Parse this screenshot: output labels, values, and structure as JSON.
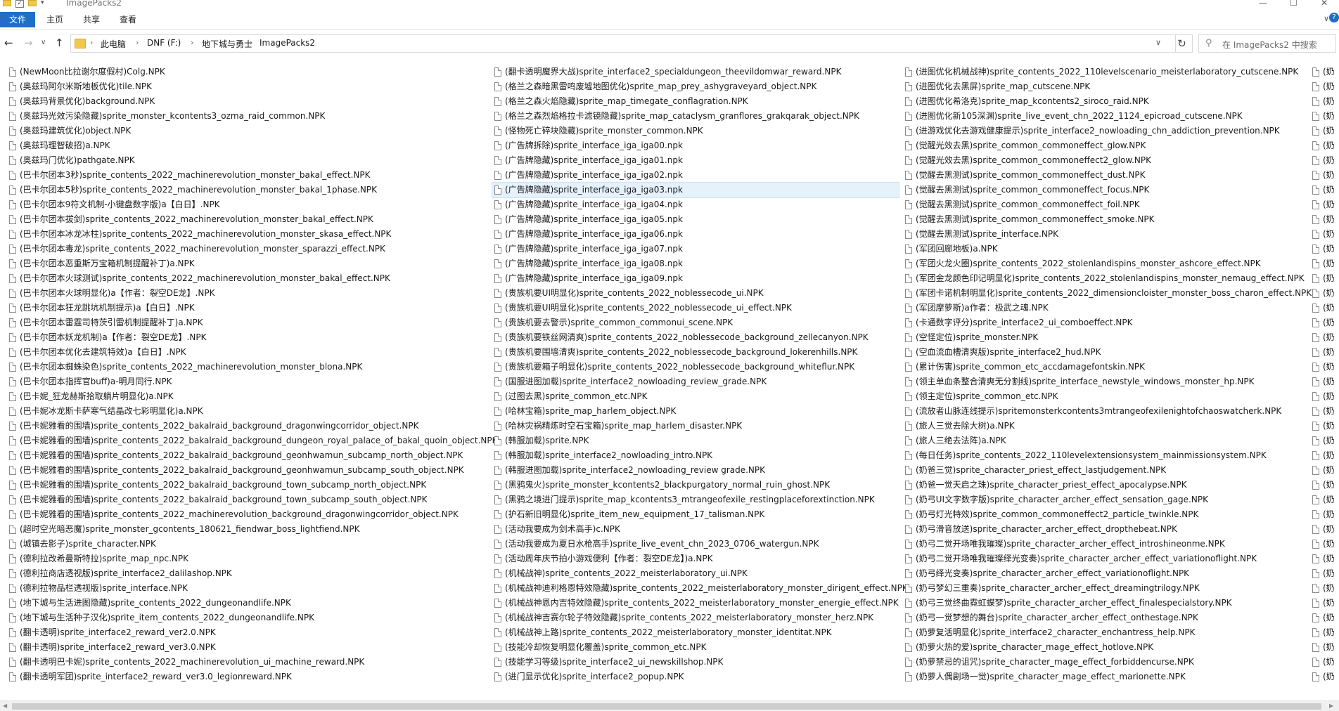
{
  "window": {
    "title": "ImagePacks2",
    "controls": {
      "minimize": "—",
      "maximize": "☐",
      "close": "✕"
    }
  },
  "ribbon": {
    "tabs": [
      "文件",
      "主页",
      "共享",
      "查看"
    ],
    "expand_glyph": "∨",
    "help_glyph": "?"
  },
  "nav": {
    "back_glyph": "←",
    "forward_glyph": "→",
    "recent_glyph": "∨",
    "up_glyph": "↑",
    "breadcrumb": [
      "此电脑",
      "DNF (F:)",
      "地下城与勇士",
      "ImagePacks2"
    ],
    "separator_glyph": "›",
    "dropdown_glyph": "∨",
    "refresh_glyph": "↻",
    "search_placeholder": "在 ImagePacks2 中搜索",
    "search_icon": "magnifier-icon"
  },
  "files": {
    "columns": [
      [
        "(NewMoon比拉谢尔度假村)Colg.NPK",
        "(奥兹玛阿尔米斯地板优化)tile.NPK",
        "(奥兹玛背景优化)background.NPK",
        "(奥兹玛光效污染隐藏)sprite_monster_kcontents3_ozma_raid_common.NPK",
        "(奥兹玛建筑优化)object.NPK",
        "(奥兹玛理智破招)a.NPK",
        "(奥兹玛门优化)pathgate.NPK",
        "(巴卡尔团本3秒)sprite_contents_2022_machinerevolution_monster_bakal_effect.NPK",
        "(巴卡尔团本5秒)sprite_contents_2022_machinerevolution_monster_bakal_1phase.NPK",
        "(巴卡尔团本9符文机制-小键盘数字版)a【白日】.NPK",
        "(巴卡尔团本拔剑)sprite_contents_2022_machinerevolution_monster_bakal_effect.NPK",
        "(巴卡尔团本冰龙冰柱)sprite_contents_2022_machinerevolution_monster_skasa_effect.NPK",
        "(巴卡尔团本毒龙)sprite_contents_2022_machinerevolution_monster_sparazzi_effect.NPK",
        "(巴卡尔团本恶重斯万宝箱机制提醒补丁)a.NPK",
        "(巴卡尔团本火球测试)sprite_contents_2022_machinerevolution_monster_bakal_effect.NPK",
        "(巴卡尔团本火球明显化)a【作者：裂空DE龙】.NPK",
        "(巴卡尔团本狂龙跳坑机制提示)a【白日】.NPK",
        "(巴卡尔团本雷霆司特茨引雷机制提醒补丁)a.NPK",
        "(巴卡尔团本妖龙机制)a【作者：裂空DE龙】.NPK",
        "(巴卡尔团本优化去建筑特效)a【白日】.NPK",
        "(巴卡尔团本蜘蛛染色)sprite_contents_2022_machinerevolution_monster_blona.NPK",
        "(巴卡尔团本指挥官buff)a-明月同行.NPK",
        "(巴卡妮_狂龙赫斯拾取躺片明显化)a.NPK",
        "(巴卡妮冰龙斯卡萨寒气结晶改七彩明显化)a.NPK",
        "(巴卡妮雅看的围墙)sprite_contents_2022_bakalraid_background_dragonwingcorridor_object.NPK",
        "(巴卡妮雅看的围墙)sprite_contents_2022_bakalraid_background_dungeon_royal_palace_of_bakal_quoin_object.NPK",
        "(巴卡妮雅看的围墙)sprite_contents_2022_bakalraid_background_geonhwamun_subcamp_north_object.NPK",
        "(巴卡妮雅看的围墙)sprite_contents_2022_bakalraid_background_geonhwamun_subcamp_south_object.NPK",
        "(巴卡妮雅看的围墙)sprite_contents_2022_bakalraid_background_town_subcamp_north_object.NPK",
        "(巴卡妮雅看的围墙)sprite_contents_2022_bakalraid_background_town_subcamp_south_object.NPK",
        "(巴卡妮雅看的围墙)sprite_contents_2022_machinerevolution_background_dragonwingcorridor_object.NPK",
        "(超时空光暗恶魔)sprite_monster_gcontents_180621_fiendwar_boss_lightfiend.NPK",
        "(城镇去影子)sprite_character.NPK",
        "(德利拉改希曼斯特拉)sprite_map_npc.NPK",
        "(德利拉商店透视版)sprite_interface2_dalilashop.NPK",
        "(德利拉物品栏透视版)sprite_interface.NPK",
        "(地下城与生活进图隐藏)sprite_contents_2022_dungeonandlife.NPK",
        "(地下城与生活种子汉化)sprite_item_contents_2022_dungeonandlife.NPK",
        "(翻卡透明)sprite_interface2_reward_ver2.0.NPK",
        "(翻卡透明)sprite_interface2_reward_ver3.0.NPK",
        "(翻卡透明巴卡妮)sprite_contents_2022_machinerevolution_ui_machine_reward.NPK",
        "(翻卡透明军团)sprite_interface2_reward_ver3.0_legionreward.NPK"
      ],
      [
        "(翻卡透明魔界大战)sprite_interface2_specialdungeon_theevildomwar_reward.NPK",
        "(格兰之森暗黑雷鸣废墟地图优化)sprite_map_prey_ashygraveyard_object.NPK",
        "(格兰之森火焰隐藏)sprite_map_timegate_conflagration.NPK",
        "(格兰之森烈焰格拉卡滤镜隐藏)sprite_map_cataclysm_granflores_grakqarak_object.NPK",
        "(怪物死亡碎块隐藏)sprite_monster_common.NPK",
        "(广告牌拆除)sprite_interface_iga_iga00.npk",
        "(广告牌隐藏)sprite_interface_iga_iga01.npk",
        "(广告牌隐藏)sprite_interface_iga_iga02.npk",
        "(广告牌隐藏)sprite_interface_iga_iga03.npk",
        "(广告牌隐藏)sprite_interface_iga_iga04.npk",
        "(广告牌隐藏)sprite_interface_iga_iga05.npk",
        "(广告牌隐藏)sprite_interface_iga_iga06.npk",
        "(广告牌隐藏)sprite_interface_iga_iga07.npk",
        "(广告牌隐藏)sprite_interface_iga_iga08.npk",
        "(广告牌隐藏)sprite_interface_iga_iga09.npk",
        "(贵族机要UI明显化)sprite_contents_2022_noblessecode_ui.NPK",
        "(贵族机要UI明显化)sprite_contents_2022_noblessecode_ui_effect.NPK",
        "(贵族机要去警示)sprite_common_commonui_scene.NPK",
        "(贵族机要铁丝网清爽)sprite_contents_2022_noblessecode_background_zellecanyon.NPK",
        "(贵族机要围墙清爽)sprite_contents_2022_noblessecode_background_lokerenhills.NPK",
        "(贵族机要箱子明显化)sprite_contents_2022_noblessecode_background_whiteflur.NPK",
        "(国服进图加载)sprite_interface2_nowloading_review_grade.NPK",
        "(过图去黑)sprite_common_etc.NPK",
        "(哈林宝箱)sprite_map_harlem_object.NPK",
        "(哈林灾祸精炼时空石宝箱)sprite_map_harlem_disaster.NPK",
        "(韩服加载)sprite.NPK",
        "(韩服加载)sprite_interface2_nowloading_intro.NPK",
        "(韩服进图加载)sprite_interface2_nowloading_review grade.NPK",
        "(黑鸦鬼火)sprite_monster_kcontents2_blackpurgatory_normal_ruin_ghost.NPK",
        "(黑鸦之境进门提示)sprite_map_kcontents3_mtrangeofexile_restingplaceforextinction.NPK",
        "(护石新旧明显化)sprite_item_new_equipment_17_talisman.NPK",
        "(活动我要成为剑术高手)c.NPK",
        "(活动我要成为夏日水枪高手)sprite_live_event_chn_2023_0706_watergun.NPK",
        "(活动周年庆节拍小游戏便利【作者：裂空DE龙】)a.NPK",
        "(机械战神)sprite_contents_2022_meisterlaboratory_ui.NPK",
        "(机械战神迪利格恩特效隐藏)sprite_contents_2022_meisterlaboratory_monster_dirigent_effect.NPK",
        "(机械战神恩内吉特效隐藏)sprite_contents_2022_meisterlaboratory_monster_energie_effect.NPK",
        "(机械战神吉赛尔轮子特效隐藏)sprite_contents_2022_meisterlaboratory_monster_herz.NPK",
        "(机械战神上路)sprite_contents_2022_meisterlaboratory_monster_identitat.NPK",
        "(技能冷却恢复明显化覆盖)sprite_common_etc.NPK",
        "(技能学习等级)sprite_interface2_ui_newskillshop.NPK",
        "(进门显示优化)sprite_interface2_popup.NPK"
      ],
      [
        "(进图优化机械战神)sprite_contents_2022_110levelscenario_meisterlaboratory_cutscene.NPK",
        "(进图优化去黑屏)sprite_map_cutscene.NPK",
        "(进图优化希洛克)sprite_map_kcontents2_siroco_raid.NPK",
        "(进图优化新105深渊)sprite_live_event_chn_2022_1124_epicroad_cutscene.NPK",
        "(进游戏优化去游戏健康提示)sprite_interface2_nowloading_chn_addiction_prevention.NPK",
        "(觉醒光效去黑)sprite_common_commoneffect_glow.NPK",
        "(觉醒光效去黑)sprite_common_commoneffect2_glow.NPK",
        "(觉醒去黑测试)sprite_common_commoneffect_dust.NPK",
        "(觉醒去黑测试)sprite_common_commoneffect_focus.NPK",
        "(觉醒去黑测试)sprite_common_commoneffect_foil.NPK",
        "(觉醒去黑测试)sprite_common_commoneffect_smoke.NPK",
        "(觉醒去黑测试)sprite_interface.NPK",
        "(军团回廊地板)a.NPK",
        "(军团火龙火圈)sprite_contents_2022_stolenlandispins_monster_ashcore_effect.NPK",
        "(军团金龙颜色印记明显化)sprite_contents_2022_stolenlandispins_monster_nemaug_effect.NPK",
        "(军团卡诺机制明显化)sprite_contents_2022_dimensioncloister_monster_boss_charon_effect.NPK",
        "(军团摩萝斯)a作者：极武之魂.NPK",
        "(卡通数字评分)sprite_interface2_ui_comboeffect.NPK",
        "(空怪定位)sprite_monster.NPK",
        "(空血流血槽清爽版)sprite_interface2_hud.NPK",
        "(累计伤害)sprite_common_etc_accdamagefontskin.NPK",
        "(领主单血条整合清爽无分割线)sprite_interface_newstyle_windows_monster_hp.NPK",
        "(领主定位)sprite_common_etc.NPK",
        "(流放者山脉连线提示)sprite​monsterkcontents3mtrangeofexilenightofchaoswatcherk.NPK",
        "(旅人三觉去除大树)a.NPK",
        "(旅人三绝去法阵)a.NPK",
        "(每日任务)sprite_contents_2022_110levelextensionsystem_mainmissionsystem.NPK",
        "(奶爸三觉)sprite_character_priest_effect_lastjudgement.NPK",
        "(奶爸一觉天启之珠)sprite_character_priest_effect_apocalypse.NPK",
        "(奶弓UI文字数字版)sprite_character_archer_effect_sensation_gage.NPK",
        "(奶弓灯光特效)sprite_common_commoneffect2_particle_twinkle.NPK",
        "(奶弓滑音放送)sprite_character_archer_effect_dropthebeat.NPK",
        "(奶弓二觉开场唯我璀璨)sprite_character_archer_effect_introshineonme.NPK",
        "(奶弓二觉开场唯我璀璨绎光变奏)sprite_character_archer_effect_variationoflight.NPK",
        "(奶弓绎光变奏)sprite_character_archer_effect_variationoflight.NPK",
        "(奶弓梦幻三重奏)sprite_character_archer_effect_dreamingtrilogy.NPK",
        "(奶弓三觉终曲霓虹蝶梦)sprite_character_archer_effect_finalespecialstory.NPK",
        "(奶弓一觉梦想的舞台)sprite_character_archer_effect_onthestage.NPK",
        "(奶萝复活明显化)sprite_interface2_character_enchantress_help.NPK",
        "(奶萝火热的爱)sprite_character_mage_effect_hotlove.NPK",
        "(奶萝禁忌的诅咒)sprite_character_mage_effect_forbiddencurse.NPK",
        "(奶萝人偶剧场一觉)sprite_character_mage_effect_marionette.NPK"
      ],
      [
        "(奶",
        "(奶",
        "(奶",
        "(奶",
        "(奶",
        "(奶",
        "(奶",
        "(奶",
        "(奶",
        "(奶",
        "(奶",
        "(奶",
        "(奶",
        "(奶",
        "(奶",
        "(奶",
        "(奶",
        "(奶",
        "(奶",
        "(奶",
        "(奶",
        "(奶",
        "(奶",
        "(奶",
        "(奶",
        "(奶",
        "(奶",
        "(奶",
        "(奶",
        "(奶",
        "(奶",
        "(奶",
        "(奶",
        "(奶",
        "(奶",
        "(奶",
        "(奶",
        "(奶",
        "(奶",
        "(奶",
        "(奶",
        "(奶"
      ]
    ],
    "selected": {
      "column": 1,
      "row": 8
    },
    "file_icon": "document-icon"
  },
  "scrollbar": {
    "left_glyph": "◀",
    "right_glyph": "▶"
  }
}
